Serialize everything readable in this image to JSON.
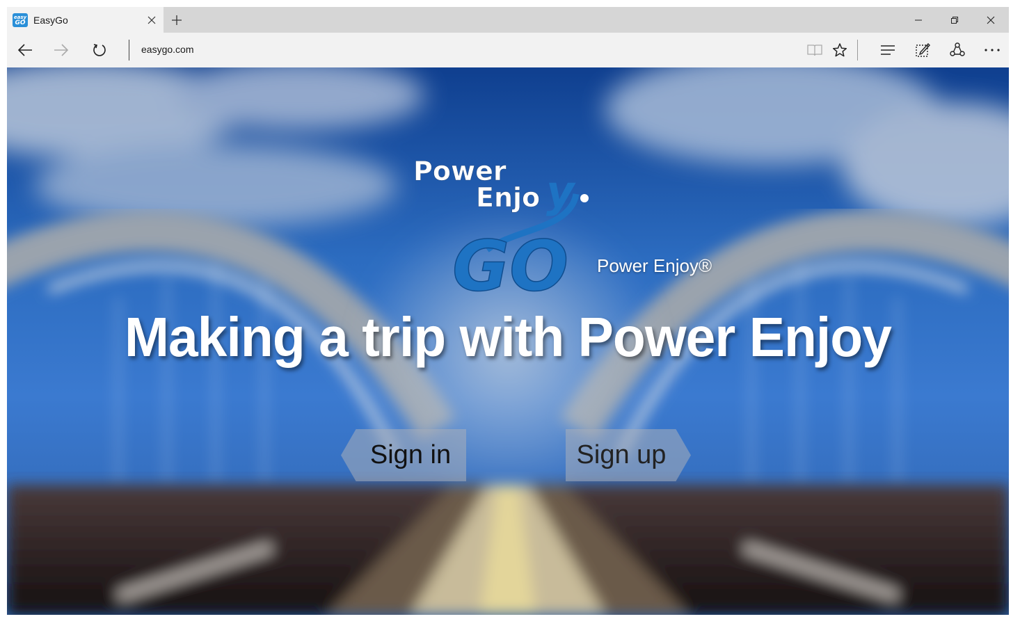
{
  "browser": {
    "tab": {
      "favicon_top": "easy",
      "favicon_bottom": "GO",
      "title": "EasyGo"
    },
    "address": "easygo.com"
  },
  "page": {
    "logo": {
      "line1": "Power",
      "line2": "Enjo",
      "line2_accent": "y",
      "mark": "GO"
    },
    "brand_label": "Power Enjoy®",
    "headline": "Making a trip with Power Enjoy",
    "sign_in_label": "Sign in",
    "sign_up_label": "Sign up"
  },
  "colors": {
    "logo_blue": "#1e73c3",
    "sky_blue": "#1f5ea6",
    "tab_strip": "#d6d6d6",
    "toolbar": "#f2f2f2"
  }
}
